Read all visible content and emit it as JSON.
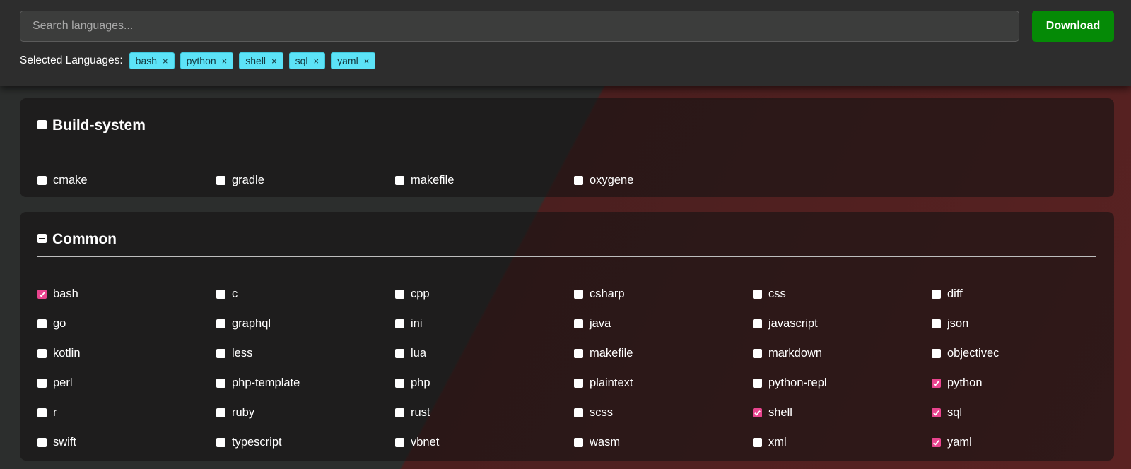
{
  "search": {
    "placeholder": "Search languages...",
    "value": ""
  },
  "download_label": "Download",
  "selected": {
    "label": "Selected Languages:",
    "tags": [
      {
        "label": "bash",
        "remove": "×"
      },
      {
        "label": "python",
        "remove": "×"
      },
      {
        "label": "shell",
        "remove": "×"
      },
      {
        "label": "sql",
        "remove": "×"
      },
      {
        "label": "yaml",
        "remove": "×"
      }
    ]
  },
  "colors": {
    "accent_check": "#e9448e",
    "download_bg": "#058a06",
    "tag_bg": "#5ce3f7"
  },
  "groups": [
    {
      "title": "Build-system",
      "state": "unchecked",
      "items": [
        {
          "label": "cmake",
          "checked": false
        },
        {
          "label": "gradle",
          "checked": false
        },
        {
          "label": "makefile",
          "checked": false
        },
        {
          "label": "oxygene",
          "checked": false
        }
      ]
    },
    {
      "title": "Common",
      "state": "indeterminate",
      "items": [
        {
          "label": "bash",
          "checked": true
        },
        {
          "label": "c",
          "checked": false
        },
        {
          "label": "cpp",
          "checked": false
        },
        {
          "label": "csharp",
          "checked": false
        },
        {
          "label": "css",
          "checked": false
        },
        {
          "label": "diff",
          "checked": false
        },
        {
          "label": "go",
          "checked": false
        },
        {
          "label": "graphql",
          "checked": false
        },
        {
          "label": "ini",
          "checked": false
        },
        {
          "label": "java",
          "checked": false
        },
        {
          "label": "javascript",
          "checked": false
        },
        {
          "label": "json",
          "checked": false
        },
        {
          "label": "kotlin",
          "checked": false
        },
        {
          "label": "less",
          "checked": false
        },
        {
          "label": "lua",
          "checked": false
        },
        {
          "label": "makefile",
          "checked": false
        },
        {
          "label": "markdown",
          "checked": false
        },
        {
          "label": "objectivec",
          "checked": false
        },
        {
          "label": "perl",
          "checked": false
        },
        {
          "label": "php-template",
          "checked": false
        },
        {
          "label": "php",
          "checked": false
        },
        {
          "label": "plaintext",
          "checked": false
        },
        {
          "label": "python-repl",
          "checked": false
        },
        {
          "label": "python",
          "checked": true
        },
        {
          "label": "r",
          "checked": false
        },
        {
          "label": "ruby",
          "checked": false
        },
        {
          "label": "rust",
          "checked": false
        },
        {
          "label": "scss",
          "checked": false
        },
        {
          "label": "shell",
          "checked": true
        },
        {
          "label": "sql",
          "checked": true
        },
        {
          "label": "swift",
          "checked": false
        },
        {
          "label": "typescript",
          "checked": false
        },
        {
          "label": "vbnet",
          "checked": false
        },
        {
          "label": "wasm",
          "checked": false
        },
        {
          "label": "xml",
          "checked": false
        },
        {
          "label": "yaml",
          "checked": true
        }
      ]
    }
  ]
}
